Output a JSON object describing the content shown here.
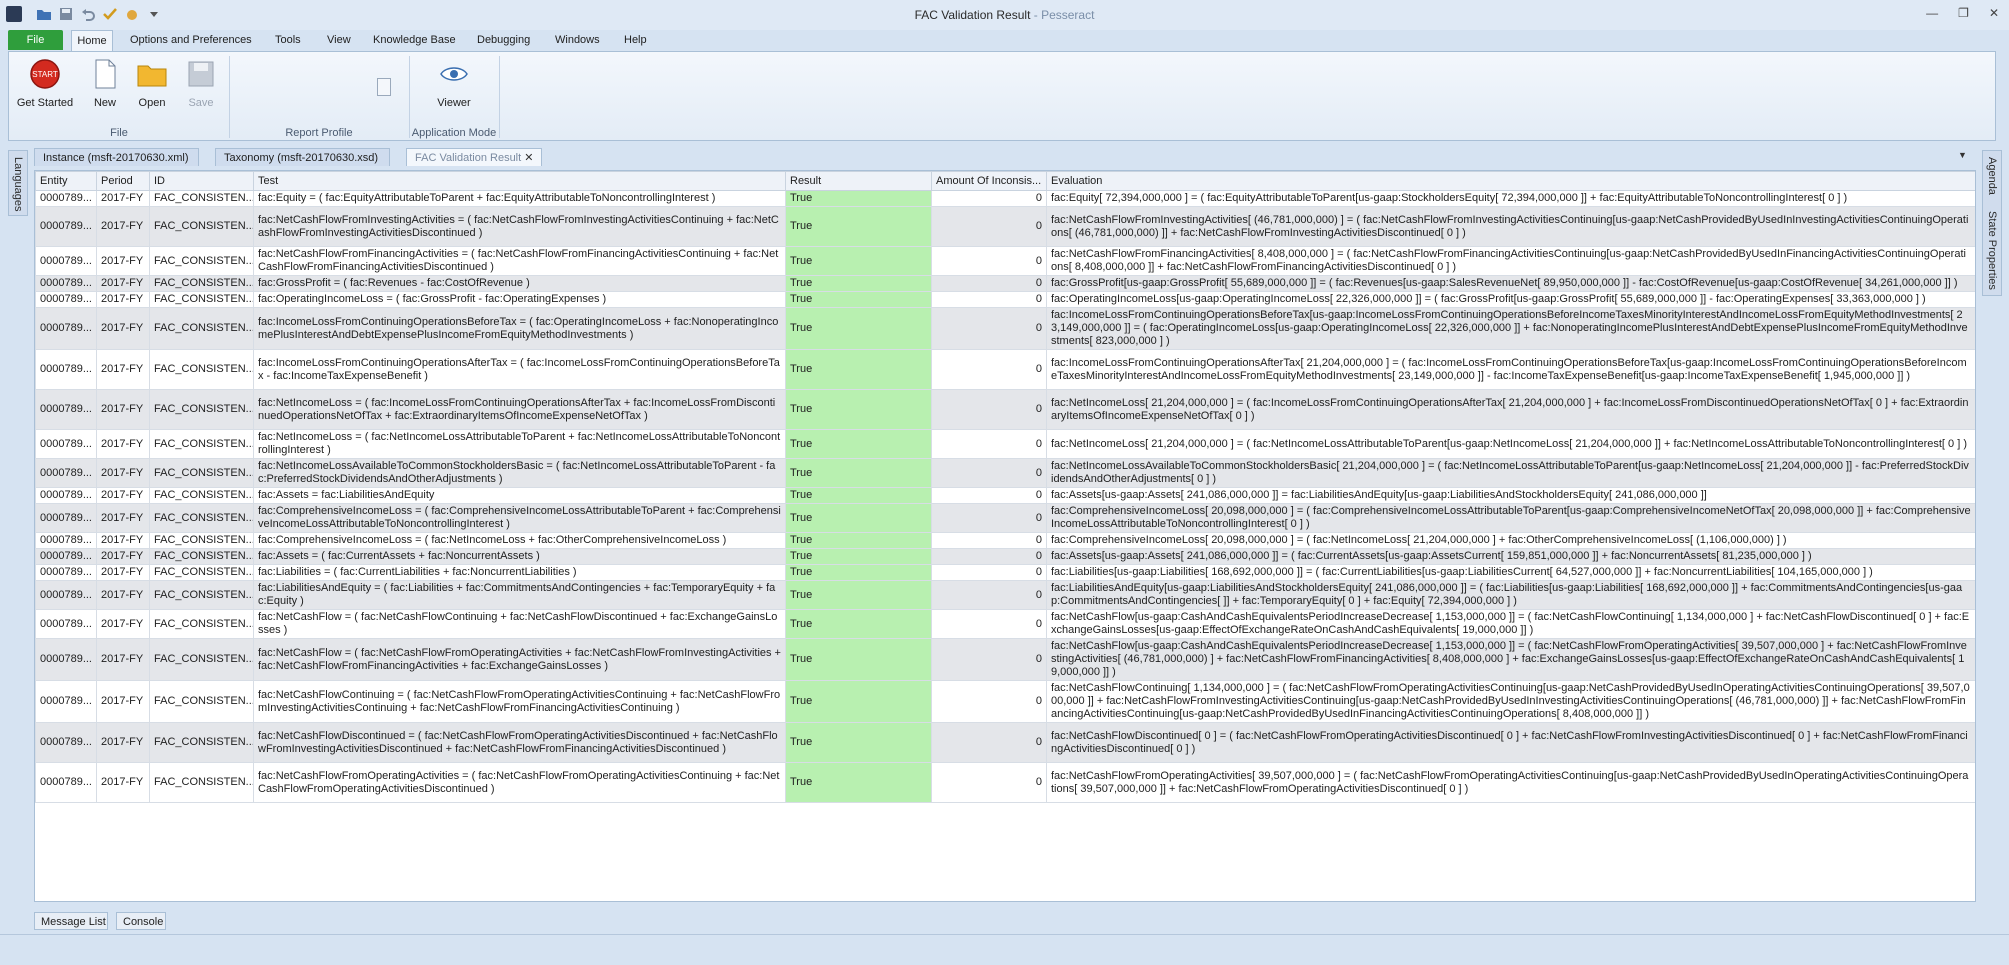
{
  "window": {
    "title": "FAC Validation Result",
    "app_name": " - Pesseract",
    "minimize": "—",
    "restore": "❐",
    "close": "✕"
  },
  "menu": {
    "file": "File",
    "items": [
      "Home",
      "Options and Preferences",
      "Tools",
      "View",
      "Knowledge Base",
      "Debugging",
      "Windows",
      "Help"
    ]
  },
  "ribbon": {
    "get_started": "Get Started",
    "start_badge": "START",
    "new": "New",
    "open": "Open",
    "save": "Save",
    "viewer": "Viewer",
    "groups": [
      "File",
      "Report Profile",
      "Application Mode"
    ]
  },
  "doc_tabs": [
    "Instance (msft-20170630.xml)",
    "Taxonomy (msft-20170630.xsd)",
    "FAC Validation Result"
  ],
  "side_panels": {
    "left": "Languages",
    "right": [
      "Agenda",
      "State Properties"
    ]
  },
  "grid": {
    "columns": [
      "Entity",
      "Period",
      "ID",
      "Test",
      "Result",
      "Amount Of Inconsis...",
      "Evaluation"
    ],
    "rows": [
      [
        "0000789...",
        "2017-FY",
        "FAC_CONSISTEN...",
        "fac:Equity = ( fac:EquityAttributableToParent + fac:EquityAttributableToNoncontrollingInterest )",
        "True",
        "0",
        "fac:Equity[ 72,394,000,000 ] = ( fac:EquityAttributableToParent[us-gaap:StockholdersEquity[ 72,394,000,000 ]] + fac:EquityAttributableToNoncontrollingInterest[ 0 ] )"
      ],
      [
        "0000789...",
        "2017-FY",
        "FAC_CONSISTEN...",
        "fac:NetCashFlowFromInvestingActivities = ( fac:NetCashFlowFromInvestingActivitiesContinuing + fac:NetCashFlowFromInvestingActivitiesDiscontinued )",
        "True",
        "0",
        "fac:NetCashFlowFromInvestingActivities[ (46,781,000,000) ] = ( fac:NetCashFlowFromInvestingActivitiesContinuing[us-gaap:NetCashProvidedByUsedInInvestingActivitiesContinuingOperations[ (46,781,000,000) ]] + fac:NetCashFlowFromInvestingActivitiesDiscontinued[ 0 ] )"
      ],
      [
        "0000789...",
        "2017-FY",
        "FAC_CONSISTEN...",
        "fac:NetCashFlowFromFinancingActivities = ( fac:NetCashFlowFromFinancingActivitiesContinuing + fac:NetCashFlowFromFinancingActivitiesDiscontinued )",
        "True",
        "0",
        "fac:NetCashFlowFromFinancingActivities[ 8,408,000,000 ] = ( fac:NetCashFlowFromFinancingActivitiesContinuing[us-gaap:NetCashProvidedByUsedInFinancingActivitiesContinuingOperations[ 8,408,000,000 ]] + fac:NetCashFlowFromFinancingActivitiesDiscontinued[ 0 ] )"
      ],
      [
        "0000789...",
        "2017-FY",
        "FAC_CONSISTEN...",
        "fac:GrossProfit = ( fac:Revenues - fac:CostOfRevenue )",
        "True",
        "0",
        "fac:GrossProfit[us-gaap:GrossProfit[ 55,689,000,000 ]] = ( fac:Revenues[us-gaap:SalesRevenueNet[ 89,950,000,000 ]] - fac:CostOfRevenue[us-gaap:CostOfRevenue[ 34,261,000,000 ]] )"
      ],
      [
        "0000789...",
        "2017-FY",
        "FAC_CONSISTEN...",
        "fac:OperatingIncomeLoss = ( fac:GrossProfit - fac:OperatingExpenses )",
        "True",
        "0",
        "fac:OperatingIncomeLoss[us-gaap:OperatingIncomeLoss[ 22,326,000,000 ]] = ( fac:GrossProfit[us-gaap:GrossProfit[ 55,689,000,000 ]] - fac:OperatingExpenses[ 33,363,000,000 ] )"
      ],
      [
        "0000789...",
        "2017-FY",
        "FAC_CONSISTEN...",
        "fac:IncomeLossFromContinuingOperationsBeforeTax = ( fac:OperatingIncomeLoss + fac:NonoperatingIncomePlusInterestAndDebtExpensePlusIncomeFromEquityMethodInvestments )",
        "True",
        "0",
        "fac:IncomeLossFromContinuingOperationsBeforeTax[us-gaap:IncomeLossFromContinuingOperationsBeforeIncomeTaxesMinorityInterestAndIncomeLossFromEquityMethodInvestments[ 23,149,000,000 ]] = ( fac:OperatingIncomeLoss[us-gaap:OperatingIncomeLoss[ 22,326,000,000 ]] + fac:NonoperatingIncomePlusInterestAndDebtExpensePlusIncomeFromEquityMethodInvestments[ 823,000,000 ] )"
      ],
      [
        "0000789...",
        "2017-FY",
        "FAC_CONSISTEN...",
        "fac:IncomeLossFromContinuingOperationsAfterTax = ( fac:IncomeLossFromContinuingOperationsBeforeTax - fac:IncomeTaxExpenseBenefit )",
        "True",
        "0",
        "fac:IncomeLossFromContinuingOperationsAfterTax[ 21,204,000,000 ] = ( fac:IncomeLossFromContinuingOperationsBeforeTax[us-gaap:IncomeLossFromContinuingOperationsBeforeIncomeTaxesMinorityInterestAndIncomeLossFromEquityMethodInvestments[ 23,149,000,000 ]] - fac:IncomeTaxExpenseBenefit[us-gaap:IncomeTaxExpenseBenefit[ 1,945,000,000 ]] )"
      ],
      [
        "0000789...",
        "2017-FY",
        "FAC_CONSISTEN...",
        "fac:NetIncomeLoss = ( fac:IncomeLossFromContinuingOperationsAfterTax + fac:IncomeLossFromDiscontinuedOperationsNetOfTax + fac:ExtraordinaryItemsOfIncomeExpenseNetOfTax )",
        "True",
        "0",
        "fac:NetIncomeLoss[ 21,204,000,000 ] = ( fac:IncomeLossFromContinuingOperationsAfterTax[ 21,204,000,000 ] + fac:IncomeLossFromDiscontinuedOperationsNetOfTax[ 0 ] + fac:ExtraordinaryItemsOfIncomeExpenseNetOfTax[ 0 ] )"
      ],
      [
        "0000789...",
        "2017-FY",
        "FAC_CONSISTEN...",
        "fac:NetIncomeLoss = ( fac:NetIncomeLossAttributableToParent + fac:NetIncomeLossAttributableToNoncontrollingInterest )",
        "True",
        "0",
        "fac:NetIncomeLoss[ 21,204,000,000 ] = ( fac:NetIncomeLossAttributableToParent[us-gaap:NetIncomeLoss[ 21,204,000,000 ]] + fac:NetIncomeLossAttributableToNoncontrollingInterest[ 0 ] )"
      ],
      [
        "0000789...",
        "2017-FY",
        "FAC_CONSISTEN...",
        "fac:NetIncomeLossAvailableToCommonStockholdersBasic = ( fac:NetIncomeLossAttributableToParent - fac:PreferredStockDividendsAndOtherAdjustments )",
        "True",
        "0",
        "fac:NetIncomeLossAvailableToCommonStockholdersBasic[ 21,204,000,000 ] = ( fac:NetIncomeLossAttributableToParent[us-gaap:NetIncomeLoss[ 21,204,000,000 ]] - fac:PreferredStockDividendsAndOtherAdjustments[ 0 ] )"
      ],
      [
        "0000789...",
        "2017-FY",
        "FAC_CONSISTEN...",
        "fac:Assets = fac:LiabilitiesAndEquity",
        "True",
        "0",
        "fac:Assets[us-gaap:Assets[ 241,086,000,000 ]] = fac:LiabilitiesAndEquity[us-gaap:LiabilitiesAndStockholdersEquity[ 241,086,000,000 ]]"
      ],
      [
        "0000789...",
        "2017-FY",
        "FAC_CONSISTEN...",
        "fac:ComprehensiveIncomeLoss = ( fac:ComprehensiveIncomeLossAttributableToParent + fac:ComprehensiveIncomeLossAttributableToNoncontrollingInterest )",
        "True",
        "0",
        "fac:ComprehensiveIncomeLoss[ 20,098,000,000 ] = ( fac:ComprehensiveIncomeLossAttributableToParent[us-gaap:ComprehensiveIncomeNetOfTax[ 20,098,000,000 ]] + fac:ComprehensiveIncomeLossAttributableToNoncontrollingInterest[ 0 ] )"
      ],
      [
        "0000789...",
        "2017-FY",
        "FAC_CONSISTEN...",
        "fac:ComprehensiveIncomeLoss = ( fac:NetIncomeLoss + fac:OtherComprehensiveIncomeLoss )",
        "True",
        "0",
        "fac:ComprehensiveIncomeLoss[ 20,098,000,000 ] = ( fac:NetIncomeLoss[ 21,204,000,000 ] + fac:OtherComprehensiveIncomeLoss[ (1,106,000,000) ] )"
      ],
      [
        "0000789...",
        "2017-FY",
        "FAC_CONSISTEN...",
        "fac:Assets = ( fac:CurrentAssets + fac:NoncurrentAssets )",
        "True",
        "0",
        "fac:Assets[us-gaap:Assets[ 241,086,000,000 ]] = ( fac:CurrentAssets[us-gaap:AssetsCurrent[ 159,851,000,000 ]] + fac:NoncurrentAssets[ 81,235,000,000 ] )"
      ],
      [
        "0000789...",
        "2017-FY",
        "FAC_CONSISTEN...",
        "fac:Liabilities = ( fac:CurrentLiabilities + fac:NoncurrentLiabilities )",
        "True",
        "0",
        "fac:Liabilities[us-gaap:Liabilities[ 168,692,000,000 ]] = ( fac:CurrentLiabilities[us-gaap:LiabilitiesCurrent[ 64,527,000,000 ]] + fac:NoncurrentLiabilities[ 104,165,000,000 ] )"
      ],
      [
        "0000789...",
        "2017-FY",
        "FAC_CONSISTEN...",
        "fac:LiabilitiesAndEquity = ( fac:Liabilities + fac:CommitmentsAndContingencies + fac:TemporaryEquity + fac:Equity )",
        "True",
        "0",
        "fac:LiabilitiesAndEquity[us-gaap:LiabilitiesAndStockholdersEquity[ 241,086,000,000 ]] = ( fac:Liabilities[us-gaap:Liabilities[ 168,692,000,000 ]] + fac:CommitmentsAndContingencies[us-gaap:CommitmentsAndContingencies[ ]] + fac:TemporaryEquity[ 0 ] + fac:Equity[ 72,394,000,000 ] )"
      ],
      [
        "0000789...",
        "2017-FY",
        "FAC_CONSISTEN...",
        "fac:NetCashFlow = ( fac:NetCashFlowContinuing + fac:NetCashFlowDiscontinued + fac:ExchangeGainsLosses )",
        "True",
        "0",
        "fac:NetCashFlow[us-gaap:CashAndCashEquivalentsPeriodIncreaseDecrease[ 1,153,000,000 ]] = ( fac:NetCashFlowContinuing[ 1,134,000,000 ] + fac:NetCashFlowDiscontinued[ 0 ] + fac:ExchangeGainsLosses[us-gaap:EffectOfExchangeRateOnCashAndCashEquivalents[ 19,000,000 ]] )"
      ],
      [
        "0000789...",
        "2017-FY",
        "FAC_CONSISTEN...",
        "fac:NetCashFlow = ( fac:NetCashFlowFromOperatingActivities + fac:NetCashFlowFromInvestingActivities + fac:NetCashFlowFromFinancingActivities + fac:ExchangeGainsLosses )",
        "True",
        "0",
        "fac:NetCashFlow[us-gaap:CashAndCashEquivalentsPeriodIncreaseDecrease[ 1,153,000,000 ]] = ( fac:NetCashFlowFromOperatingActivities[ 39,507,000,000 ] + fac:NetCashFlowFromInvestingActivities[ (46,781,000,000) ] + fac:NetCashFlowFromFinancingActivities[ 8,408,000,000 ] + fac:ExchangeGainsLosses[us-gaap:EffectOfExchangeRateOnCashAndCashEquivalents[ 19,000,000 ]] )"
      ],
      [
        "0000789...",
        "2017-FY",
        "FAC_CONSISTEN...",
        "fac:NetCashFlowContinuing = ( fac:NetCashFlowFromOperatingActivitiesContinuing + fac:NetCashFlowFromInvestingActivitiesContinuing + fac:NetCashFlowFromFinancingActivitiesContinuing )",
        "True",
        "0",
        "fac:NetCashFlowContinuing[ 1,134,000,000 ] = ( fac:NetCashFlowFromOperatingActivitiesContinuing[us-gaap:NetCashProvidedByUsedInOperatingActivitiesContinuingOperations[ 39,507,000,000 ]] + fac:NetCashFlowFromInvestingActivitiesContinuing[us-gaap:NetCashProvidedByUsedInInvestingActivitiesContinuingOperations[ (46,781,000,000) ]] + fac:NetCashFlowFromFinancingActivitiesContinuing[us-gaap:NetCashProvidedByUsedInFinancingActivitiesContinuingOperations[ 8,408,000,000 ]] )"
      ],
      [
        "0000789...",
        "2017-FY",
        "FAC_CONSISTEN...",
        "fac:NetCashFlowDiscontinued = ( fac:NetCashFlowFromOperatingActivitiesDiscontinued + fac:NetCashFlowFromInvestingActivitiesDiscontinued + fac:NetCashFlowFromFinancingActivitiesDiscontinued )",
        "True",
        "0",
        "fac:NetCashFlowDiscontinued[ 0 ] = ( fac:NetCashFlowFromOperatingActivitiesDiscontinued[ 0 ] + fac:NetCashFlowFromInvestingActivitiesDiscontinued[ 0 ] + fac:NetCashFlowFromFinancingActivitiesDiscontinued[ 0 ] )"
      ],
      [
        "0000789...",
        "2017-FY",
        "FAC_CONSISTEN...",
        "fac:NetCashFlowFromOperatingActivities = ( fac:NetCashFlowFromOperatingActivitiesContinuing + fac:NetCashFlowFromOperatingActivitiesDiscontinued )",
        "True",
        "0",
        "fac:NetCashFlowFromOperatingActivities[ 39,507,000,000 ] = ( fac:NetCashFlowFromOperatingActivitiesContinuing[us-gaap:NetCashProvidedByUsedInOperatingActivitiesContinuingOperations[ 39,507,000,000 ]] + fac:NetCashFlowFromOperatingActivitiesDiscontinued[ 0 ] )"
      ]
    ]
  },
  "bottom_tabs": [
    "Message List",
    "Console"
  ]
}
